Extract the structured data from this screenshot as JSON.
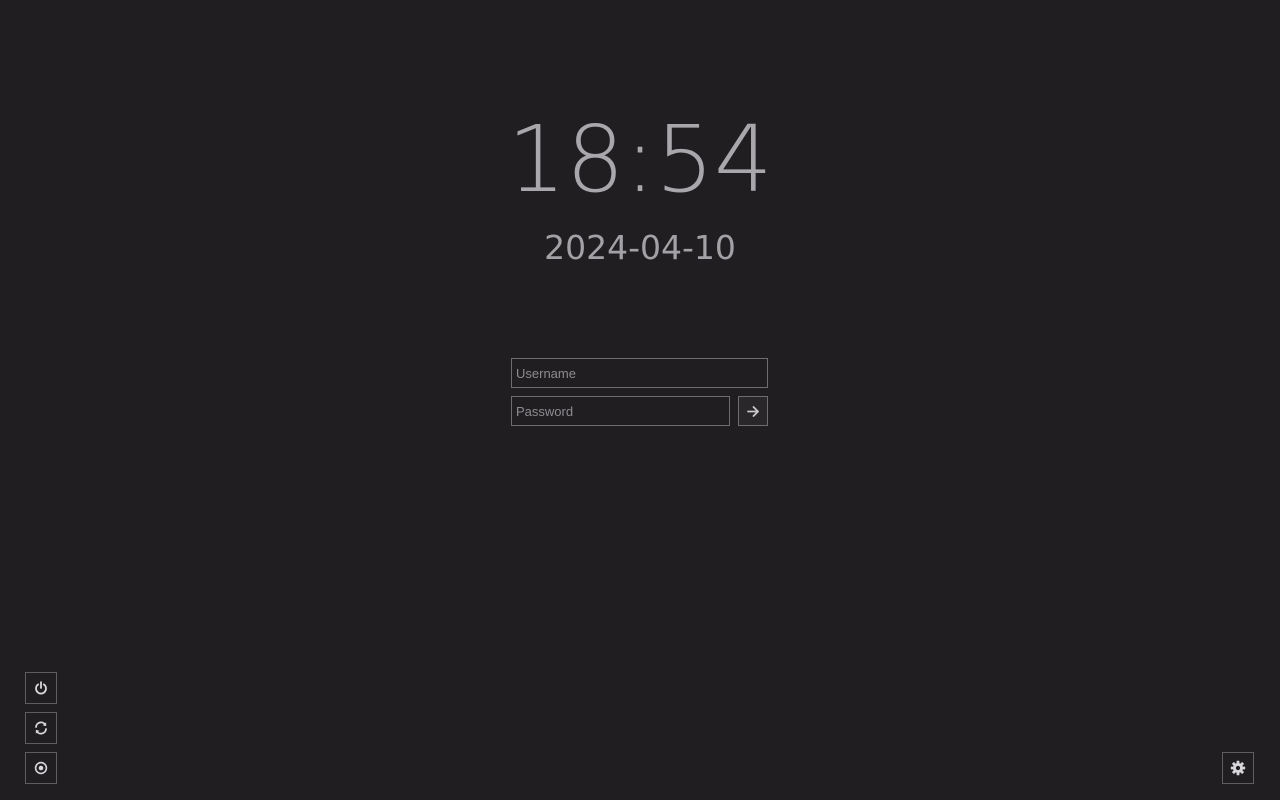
{
  "clock": {
    "time": "18:54",
    "date": "2024-04-10"
  },
  "login": {
    "username_placeholder": "Username",
    "username_value": "",
    "password_placeholder": "Password",
    "password_value": "",
    "submit_icon": "arrow-right-icon"
  },
  "power_actions": [
    {
      "icon": "power-icon",
      "action": "shutdown"
    },
    {
      "icon": "refresh-icon",
      "action": "reboot"
    },
    {
      "icon": "suspend-icon",
      "action": "suspend"
    }
  ],
  "settings": {
    "icon": "gear-icon"
  },
  "colors": {
    "background": "#201e21",
    "text": "#a3a1a5",
    "border": "#6e6c70"
  }
}
